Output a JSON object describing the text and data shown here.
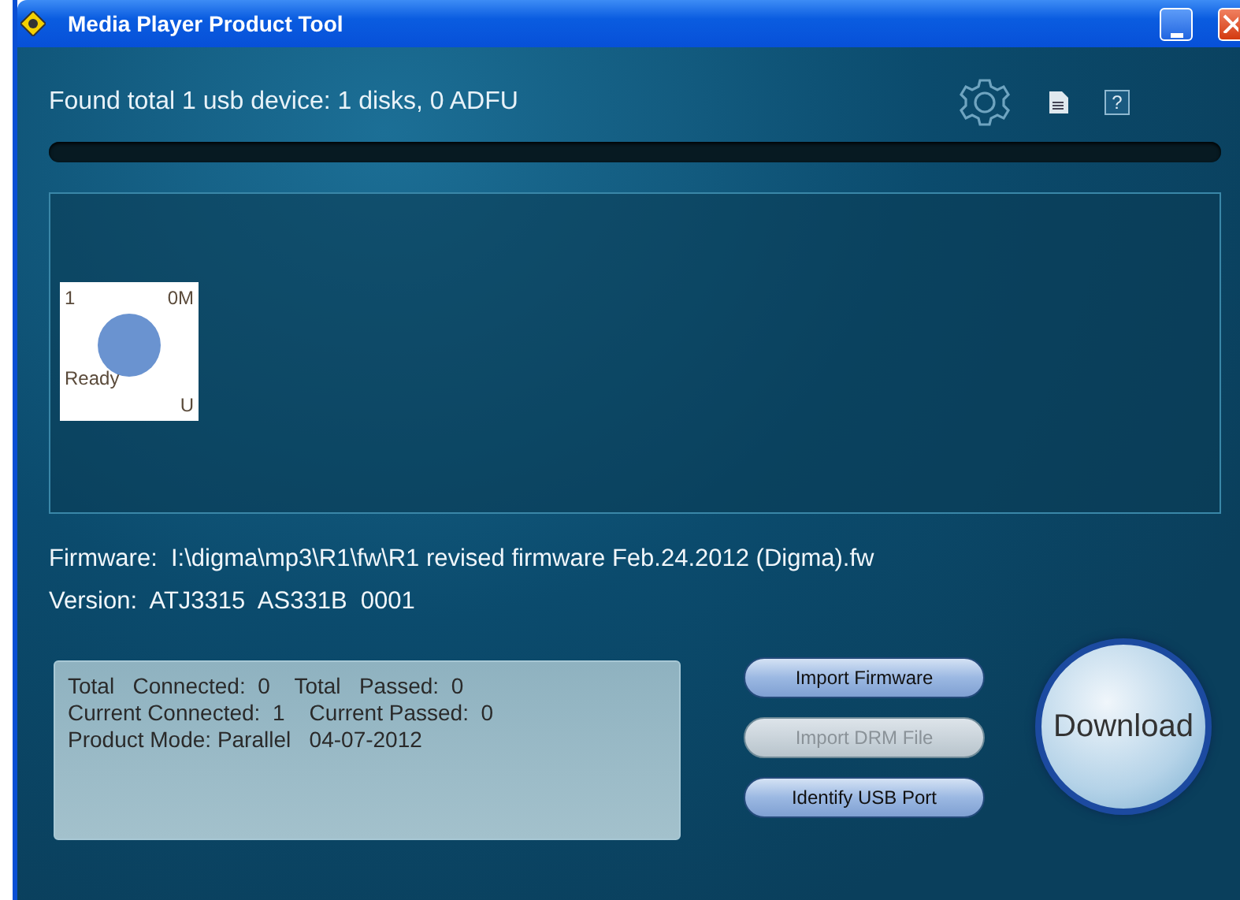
{
  "window": {
    "title": "Media Player Product Tool"
  },
  "status": "Found total 1 usb device: 1 disks, 0 ADFU",
  "toolbar": {
    "help_glyph": "?"
  },
  "progress": {
    "level": 0
  },
  "devices": [
    {
      "index": "1",
      "size": "0M",
      "state": "Ready",
      "mode": "U"
    }
  ],
  "firmware": {
    "label": "Firmware:",
    "value": "I:\\digma\\mp3\\R1\\fw\\R1 revised firmware Feb.24.2012 (Digma).fw"
  },
  "version": {
    "label": "Version:",
    "value": "ATJ3315  AS331B  0001"
  },
  "stats": [
    "Total   Connected:  0    Total   Passed:  0",
    "Current Connected:  1    Current Passed:  0",
    "Product Mode: Parallel   04-07-2012"
  ],
  "buttons": [
    {
      "label": "Import Firmware",
      "disabled": false
    },
    {
      "label": "Import DRM File",
      "disabled": true
    },
    {
      "label": "Identify USB Port",
      "disabled": false
    }
  ],
  "download": {
    "label": "Download"
  }
}
